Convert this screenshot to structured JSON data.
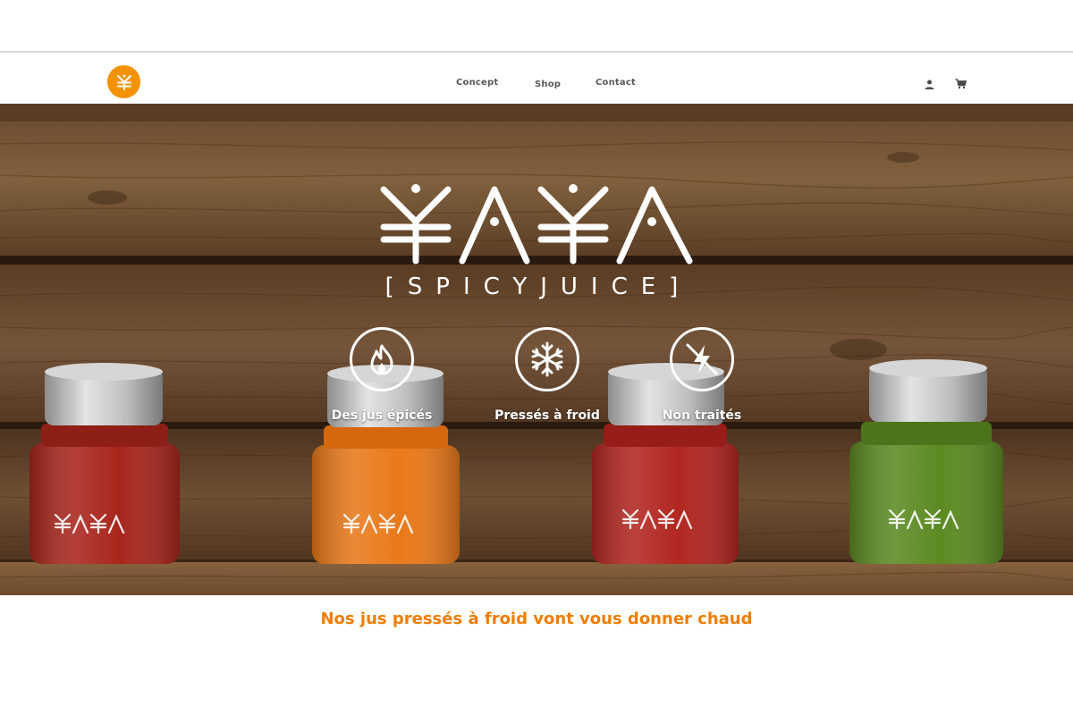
{
  "nav": {
    "links": [
      {
        "label": "Concept"
      },
      {
        "label": "Shop"
      },
      {
        "label": "Contact"
      }
    ],
    "icons": [
      "user-icon",
      "cart-icon"
    ]
  },
  "hero": {
    "brand_name": "YAYA",
    "brand_subtitle": "[SPICYJUICE]",
    "features": [
      {
        "label": "Des jus épicés",
        "icon": "flame-icon"
      },
      {
        "label": "Pressés à froid",
        "icon": "snowflake-icon"
      },
      {
        "label": "Non traités",
        "icon": "no-lightning-icon"
      }
    ],
    "bottle_colors": [
      "#a8261c",
      "#e9791a",
      "#b22620",
      "#5c8a22"
    ]
  },
  "tagline": "Nos jus pressés à froid vont vous donner chaud",
  "colors": {
    "accent": "#f39200",
    "tagline": "#f07d00",
    "nav_text": "#5a5a5a"
  }
}
